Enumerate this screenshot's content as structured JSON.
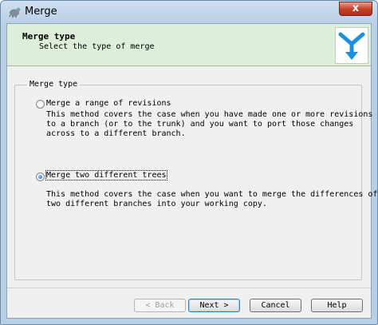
{
  "window": {
    "title": "Merge",
    "close_label": "x"
  },
  "header": {
    "title": "Merge type",
    "subtitle": "Select the type of merge"
  },
  "group": {
    "label": "Merge type"
  },
  "options": [
    {
      "label": "Merge a range of revisions",
      "checked": false,
      "description": "This method covers the case when you have made one or more revisions\nto a branch (or to the trunk) and you want to port those changes\nacross to a different branch."
    },
    {
      "label": "Merge two different trees",
      "checked": true,
      "description": "This method covers the case when you want to merge the differences of\ntwo different branches into your working copy."
    }
  ],
  "buttons": {
    "back": "< Back",
    "next": "Next >",
    "cancel": "Cancel",
    "help": "Help"
  },
  "colors": {
    "header_bg": "#ddeed9",
    "logo_blue": "#1d8fe0"
  }
}
